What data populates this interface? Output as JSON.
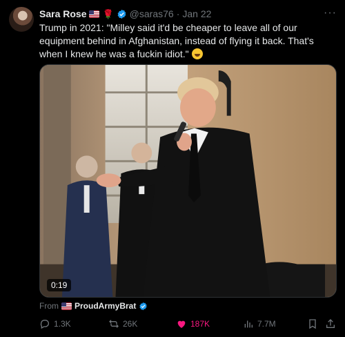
{
  "post": {
    "author_name": "Sara Rose",
    "handle": "@saras76",
    "separator": "·",
    "date": "Jan 22",
    "text": "Trump in 2021: \"Milley said it'd be cheaper to leave all of our equipment behind in Afghanistan,  instead of flying it back. That's when I knew he was a fuckin idiot.\"",
    "emoji": "face-with-tears-of-joy",
    "more_label": "···"
  },
  "media": {
    "type": "video",
    "duration": "0:19"
  },
  "attribution": {
    "prefix": "From",
    "account": "ProudArmyBrat"
  },
  "actions": {
    "replies": "1.3K",
    "reposts": "26K",
    "likes": "187K",
    "views": "7.7M"
  },
  "colors": {
    "background": "#000000",
    "text": "#e7e9ea",
    "muted": "#71767b",
    "verified": "#1d9bf0",
    "like": "#f91880"
  }
}
